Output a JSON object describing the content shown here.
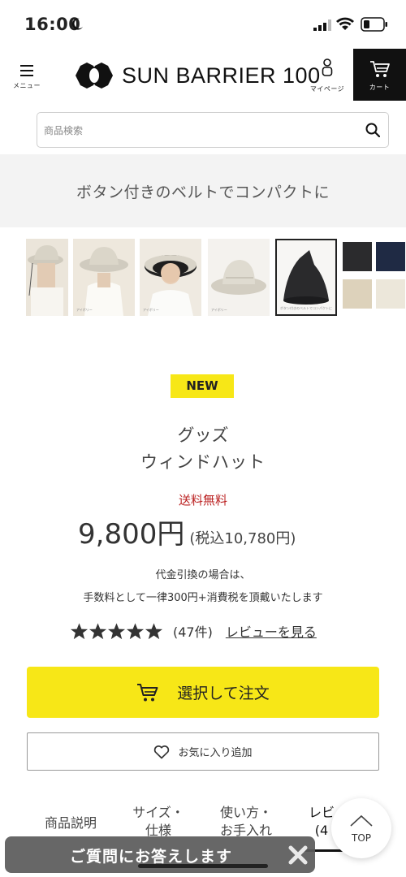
{
  "status": {
    "time": "16:00"
  },
  "header": {
    "menu_label": "メニュー",
    "logo_text": "SUN BARRIER 100",
    "mypage_label": "マイページ",
    "cart_label": "カート"
  },
  "search": {
    "placeholder": "商品検索"
  },
  "banner": {
    "text": "ボタン付きのベルトでコンパクトに"
  },
  "thumbnails": [
    {
      "caption": ""
    },
    {
      "caption": "アイボリー"
    },
    {
      "caption": "アイボリー"
    },
    {
      "caption": "アイボリー"
    },
    {
      "caption": "ボタン付きのベルトでコンパクトに"
    }
  ],
  "swatches": [
    {
      "name": "ブラック",
      "color": "#2b2b2d"
    },
    {
      "name": "ネイビー",
      "color": "#1f2a44"
    },
    {
      "name": "ベージュ",
      "color": "#ddd2bb"
    },
    {
      "name": "アイボリー",
      "color": "#ece7da"
    }
  ],
  "product": {
    "badge": "NEW",
    "category": "グッズ",
    "name": "ウィンドハット",
    "shipping": "送料無料",
    "price": "9,800円",
    "price_tax": "(税込10,780円)",
    "cod_line1": "代金引換の場合は、",
    "cod_line2": "手数料として一律300円+消費税を頂戴いたします",
    "rating": 5,
    "review_count": "(47件)",
    "review_link": "レビューを見る"
  },
  "actions": {
    "order_label": "選択して注文",
    "favorite_label": "お気に入り追加"
  },
  "tabs": [
    {
      "line1": "商品説明",
      "line2": ""
    },
    {
      "line1": "サイズ・",
      "line2": "仕様"
    },
    {
      "line1": "使い方・",
      "line2": "お手入れ"
    },
    {
      "line1": "レビ",
      "line2": "(4"
    }
  ],
  "chat": {
    "text": "ご質問にお答えします"
  },
  "top_button": {
    "label": "TOP"
  },
  "colors": {
    "accent_yellow": "#f7e717",
    "shipping_red": "#b22222",
    "cart_bg": "#111111"
  }
}
